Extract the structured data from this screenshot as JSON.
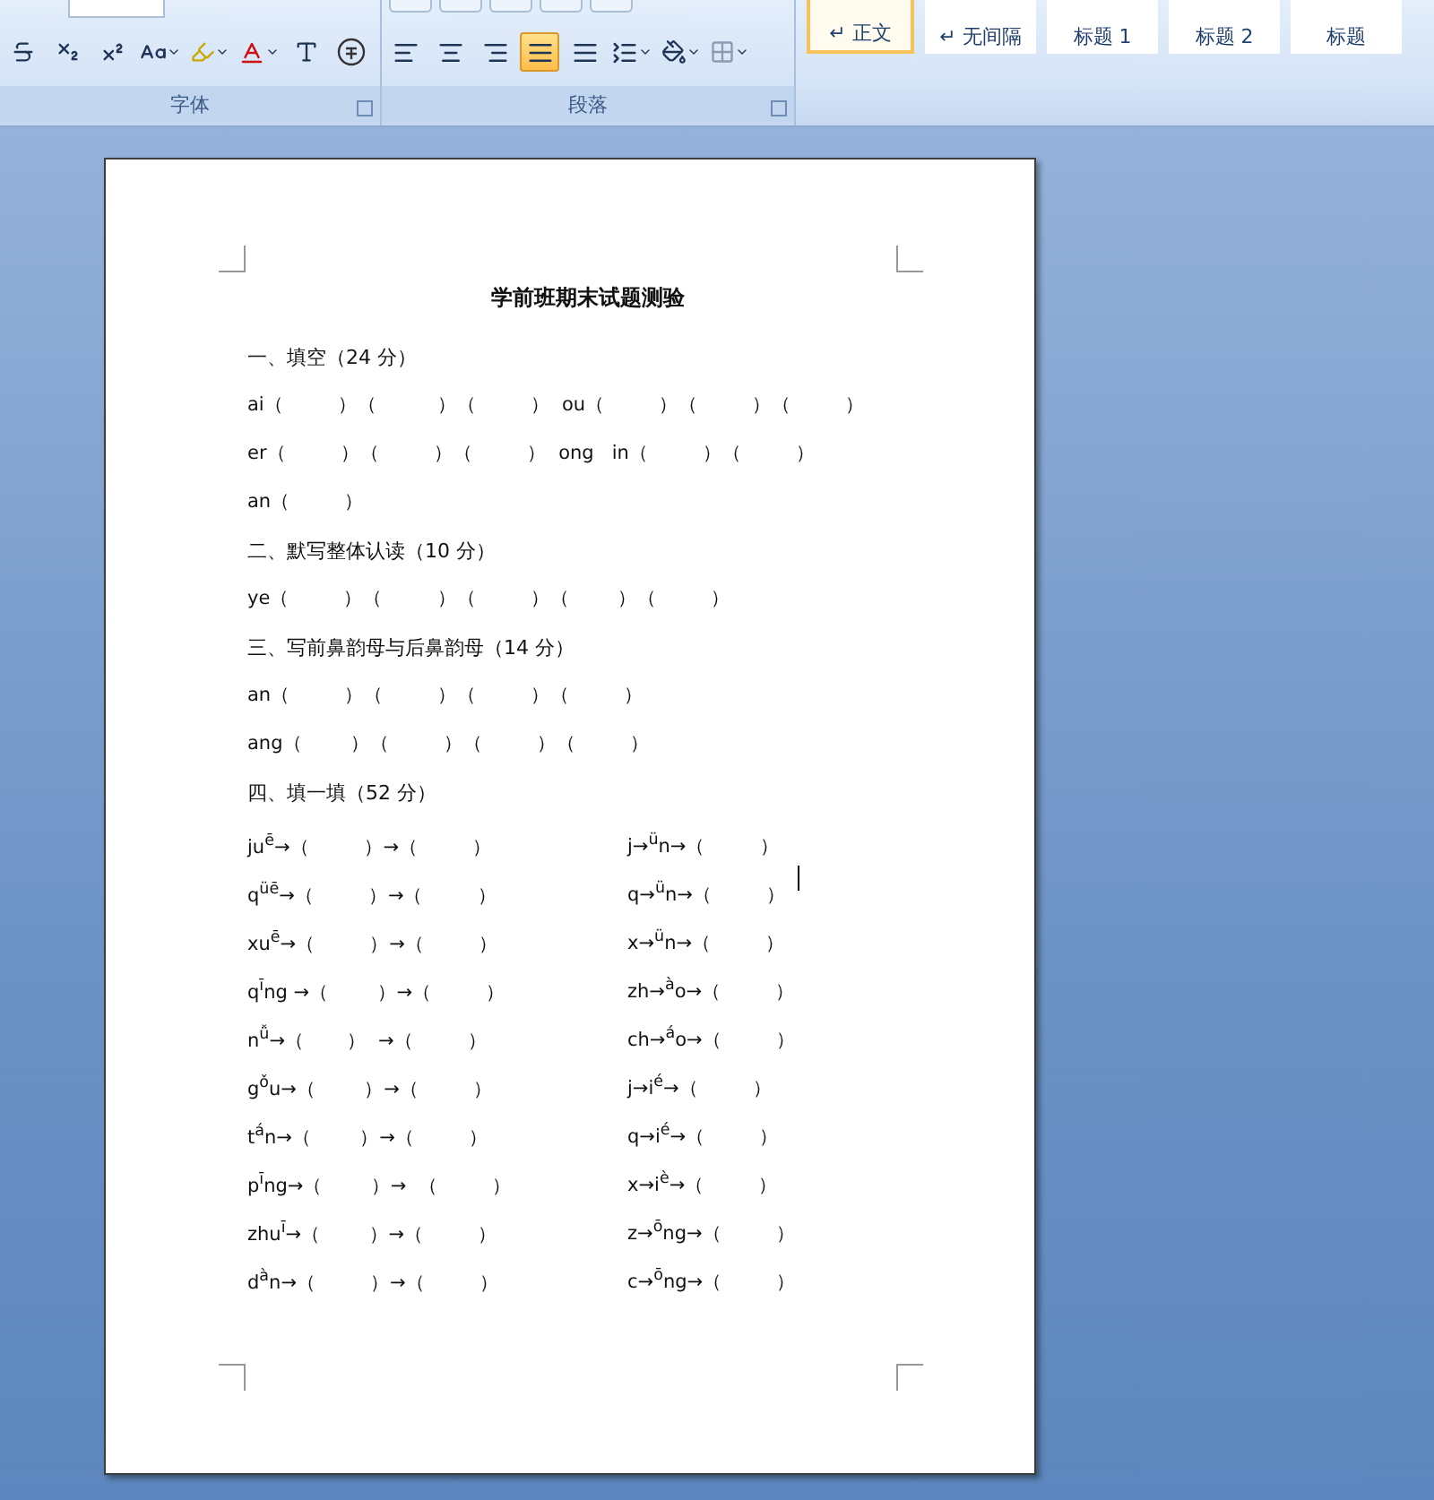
{
  "ribbon": {
    "groups": [
      {
        "kind": "font",
        "label": "字体"
      },
      {
        "kind": "paragraph",
        "label": "段落"
      }
    ],
    "paragraph_tools": [
      {
        "kind": "left",
        "selected": false
      },
      {
        "kind": "center",
        "selected": false
      },
      {
        "kind": "right",
        "selected": false
      },
      {
        "kind": "justify",
        "selected": true
      },
      {
        "kind": "distributed",
        "selected": false
      }
    ],
    "styles": [
      {
        "label": "正文",
        "mark": "↵",
        "selected": true
      },
      {
        "label": "无间隔",
        "mark": "↵",
        "selected": false
      },
      {
        "label": "标题 1",
        "selected": false
      },
      {
        "label": "标题 2",
        "selected": false
      },
      {
        "label": "标题",
        "selected": false
      }
    ]
  },
  "document": {
    "lines": [
      {
        "kind": "title",
        "text": "学前班期末试题测验"
      },
      {
        "kind": "heading",
        "text": "一、填空（24 分）"
      },
      {
        "kind": "line",
        "text": "ai（         ）（          ）（         ）  ou（         ）（         ）（         ）"
      },
      {
        "kind": "line",
        "text": "er（         ）（         ）（         ）  ong   in（         ）（         ）"
      },
      {
        "kind": "line",
        "text": "an（         ）"
      },
      {
        "kind": "heading",
        "text": "二、默写整体认读（10 分）"
      },
      {
        "kind": "line",
        "text": "ye（         ）（         ）（         ）（        ）（         ）"
      },
      {
        "kind": "heading",
        "text": "三、写前鼻韵母与后鼻韵母（14 分）"
      },
      {
        "kind": "line",
        "text": "an（         ）（         ）（         ）（         ）"
      },
      {
        "kind": "line",
        "text": "ang（        ）（         ）（         ）（         ）"
      },
      {
        "kind": "heading",
        "text": "四、填一填（52 分）"
      },
      {
        "kind": "pair",
        "left": "ju$^{ē}$→（         ）→（         ）",
        "right": "j→$^{ü}$n→（         ）"
      },
      {
        "kind": "pair",
        "left": "q$^{üē}$→（         ）→（         ）",
        "right": "q→$^{ü}$n→（         ）"
      },
      {
        "kind": "pair",
        "left": "xu$^{ē}$→（         ）→（         ）",
        "right": "x→$^{ü}$n→（         ）"
      },
      {
        "kind": "pair",
        "left": "q$^{ī}$ng →（        ）→（         ）",
        "right": "zh→$^{à}$o→（         ）"
      },
      {
        "kind": "pair",
        "left": "n$^{ǚ}$→（       ）  →（         ）",
        "right": "ch→$^{á}$o→（         ）"
      },
      {
        "kind": "pair",
        "left": "g$^{ǒ}$u→（        ）→（         ）",
        "right": "j→i$^{é}$→（         ）"
      },
      {
        "kind": "pair",
        "left": "t$^{á}$n→（        ）→（         ）",
        "right": "q→i$^{é}$→（         ）"
      },
      {
        "kind": "pair",
        "left": "p$^{ī}$ng→（        ）→  （         ）",
        "right": "x→i$^{è}$→（         ）"
      },
      {
        "kind": "pair",
        "left": "zhu$^{ī}$→（        ）→（         ）",
        "right": "z→$^{ō}$ng→（         ）"
      },
      {
        "kind": "pair",
        "left": "d$^{à}$n→（         ）→（         ）",
        "right": "c→$^{ō}$ng→（         ）"
      }
    ]
  }
}
